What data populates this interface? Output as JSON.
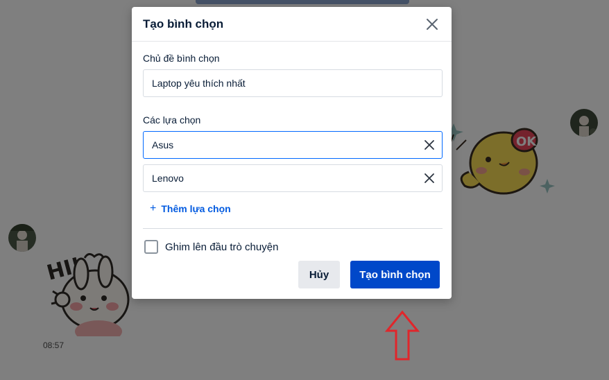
{
  "background": {
    "message_time": "08:57"
  },
  "modal": {
    "title": "Tạo bình chọn",
    "topic_label": "Chủ đề bình chọn",
    "topic_value": "Laptop yêu thích nhất",
    "options_label": "Các lựa chọn",
    "options": [
      {
        "value": "Asus"
      },
      {
        "value": "Lenovo"
      }
    ],
    "add_option_label": "Thêm lựa chọn",
    "pin_label": "Ghim lên đầu trò chuyện",
    "pin_checked": false,
    "cancel_label": "Hủy",
    "create_label": "Tạo bình chọn"
  },
  "colors": {
    "primary": "#0048c9",
    "link": "#005ae0",
    "overlay": "rgba(0,0,0,0.5)",
    "arrow": "#e0262b"
  },
  "icons": {
    "close": "close-icon",
    "clear_option": "x-icon",
    "add": "plus-icon",
    "annotation": "red-arrow-up"
  }
}
